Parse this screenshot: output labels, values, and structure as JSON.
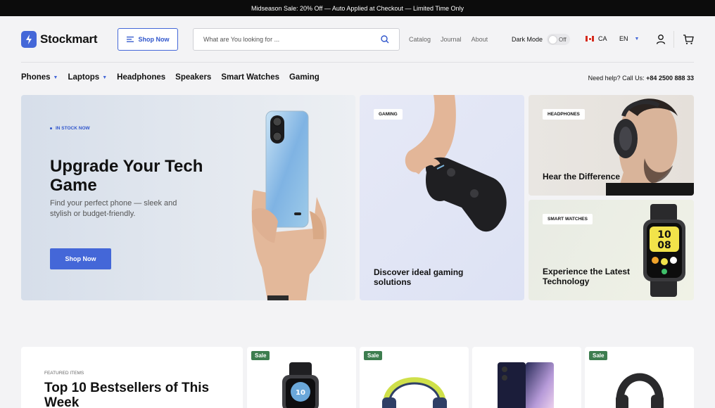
{
  "topbar": {
    "text": "Midseason Sale: 20% Off — Auto Applied at Checkout — Limited Time Only"
  },
  "brand": {
    "name": "Stockmart",
    "accent": "#4467d8"
  },
  "header": {
    "shop_now": "Shop Now",
    "search_placeholder": "What are You looking for ...",
    "links": [
      "Catalog",
      "Journal",
      "About"
    ],
    "dark_mode_label": "Dark Mode",
    "dark_mode_state": "Off",
    "country": "CA",
    "language": "EN"
  },
  "categories": [
    {
      "label": "Phones",
      "dropdown": true
    },
    {
      "label": "Laptops",
      "dropdown": true
    },
    {
      "label": "Headphones",
      "dropdown": false
    },
    {
      "label": "Speakers",
      "dropdown": false
    },
    {
      "label": "Smart Watches",
      "dropdown": false
    },
    {
      "label": "Gaming",
      "dropdown": false
    }
  ],
  "help": {
    "prefix": "Need help? Call Us:",
    "phone": "+84 2500 888 33"
  },
  "hero": {
    "tag": "IN STOCK NOW",
    "title": "Upgrade Your Tech Game",
    "subtitle": "Find your perfect phone — sleek and stylish or budget-friendly.",
    "button": "Shop Now"
  },
  "promo_cards": {
    "gaming": {
      "tag": "GAMING",
      "title": "Discover ideal gaming solutions"
    },
    "headphones": {
      "tag": "HEADPHONES",
      "title": "Hear the Difference"
    },
    "watches": {
      "tag": "SMART WATCHES",
      "title": "Experience the Latest Technology",
      "watch_time": "10\n08"
    }
  },
  "featured": {
    "label": "FEATURED ITEMS",
    "title": "Top 10 Bestsellers of This Week"
  },
  "products": [
    {
      "badge": "Sale",
      "icon": "smartwatch-image"
    },
    {
      "badge": "Sale",
      "icon": "headphones-image"
    },
    {
      "badge": "",
      "icon": "phone-image"
    },
    {
      "badge": "Sale",
      "icon": "headphones-image"
    }
  ]
}
